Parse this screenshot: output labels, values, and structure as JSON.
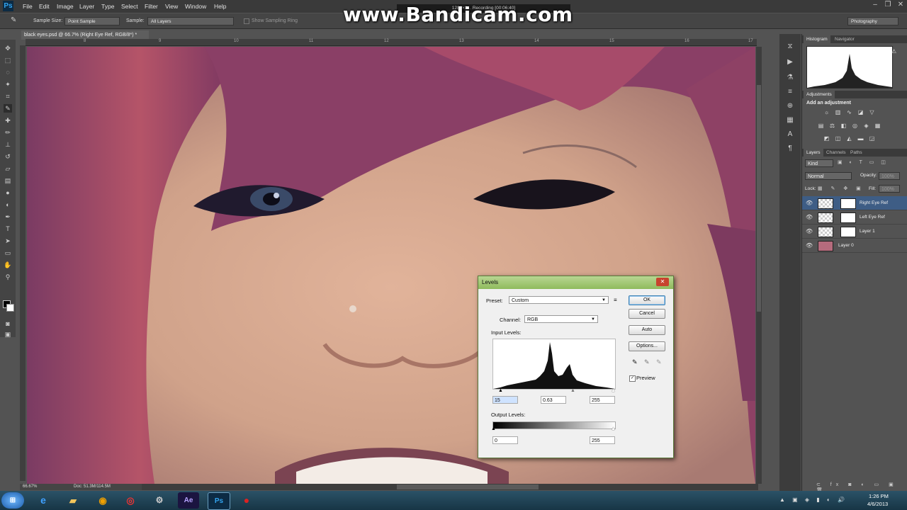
{
  "app": {
    "logo": "Ps",
    "menu": [
      "File",
      "Edit",
      "Image",
      "Layer",
      "Type",
      "Select",
      "Filter",
      "View",
      "Window",
      "Help"
    ],
    "workspace": "Photography",
    "window_controls": [
      "–",
      "❐",
      "✕"
    ]
  },
  "watermark": {
    "text": "www.Bandicam.com",
    "recording": "1280×1... Recording [00:06:40]"
  },
  "options_bar": {
    "sample_size_label": "Sample Size:",
    "sample_size_value": "Point Sample",
    "sample_label": "Sample:",
    "sample_value": "All Layers",
    "show_sampling_ring": "Show Sampling Ring"
  },
  "document": {
    "tab_title": "black eyes.psd @ 66.7% (Right Eye Ref, RGB/8*) *",
    "ruler_top": [
      "8",
      "9",
      "10",
      "11",
      "12",
      "13",
      "14",
      "15",
      "16",
      "17"
    ],
    "zoom": "66.67%",
    "doc_info": "Doc: 51.3M/114.5M"
  },
  "panels": {
    "histogram_tab": "Histogram",
    "navigator_tab": "Navigator",
    "adjustments_tab": "Adjustments",
    "add_adjustment": "Add an adjustment",
    "layers_tab": "Layers",
    "channels_tab": "Channels",
    "paths_tab": "Paths",
    "kind_filter": "Kind",
    "blend_mode": "Normal",
    "opacity_label": "Opacity:",
    "opacity_value": "100%",
    "lock_label": "Lock:",
    "fill_label": "Fill:",
    "fill_value": "100%",
    "layers": [
      {
        "name": "Right Eye Ref",
        "selected": true
      },
      {
        "name": "Left Eye Ref",
        "selected": false
      },
      {
        "name": "Layer 1",
        "selected": false
      },
      {
        "name": "Layer 0",
        "selected": false
      }
    ]
  },
  "levels_dialog": {
    "title": "Levels",
    "preset_label": "Preset:",
    "preset_value": "Custom",
    "channel_label": "Channel:",
    "channel_value": "RGB",
    "input_levels_label": "Input Levels:",
    "input_black": "15",
    "input_gamma": "0.63",
    "input_white": "255",
    "output_levels_label": "Output Levels:",
    "output_black": "0",
    "output_white": "255",
    "ok_label": "OK",
    "cancel_label": "Cancel",
    "auto_label": "Auto",
    "options_label": "Options...",
    "preview_label": "Preview",
    "preview_checked": true
  },
  "taskbar": {
    "time": "1:26 PM",
    "date": "4/6/2013",
    "apps": [
      "Internet Explorer",
      "File Explorer",
      "Media Player",
      "Chrome",
      "Misc",
      "After Effects",
      "Photoshop",
      "Bandicam"
    ],
    "ae_label": "Ae",
    "ps_label": "Ps"
  },
  "colors": {
    "accent": "#3e5d85",
    "dialog_title": "#8fbb5c",
    "taskbar": "#173545"
  }
}
